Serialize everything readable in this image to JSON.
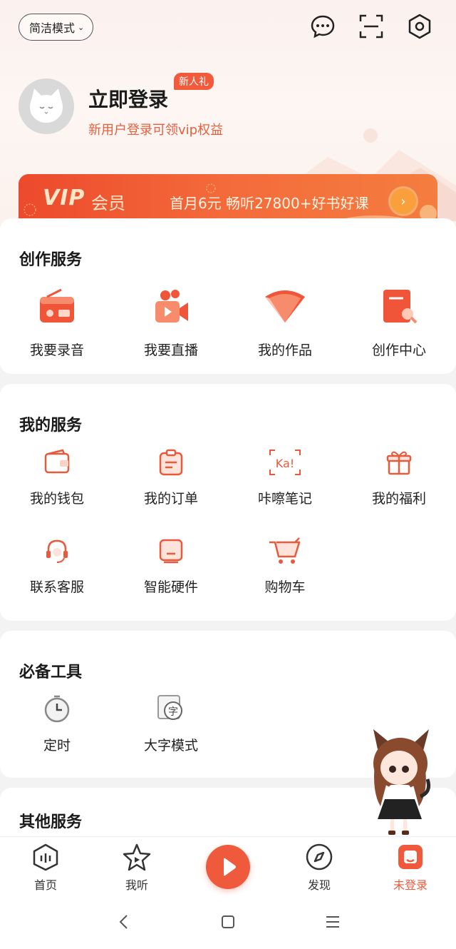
{
  "header": {
    "mode_label": "简洁模式",
    "icons": [
      "message-icon",
      "scan-icon",
      "settings-icon"
    ]
  },
  "profile": {
    "title": "立即登录",
    "badge": "新人礼",
    "subtitle": "新用户登录可领vip权益"
  },
  "vip": {
    "logo": "VIP",
    "member": "会员",
    "promo": "首月6元 畅听27800+好书好课"
  },
  "creation": {
    "title": "创作服务",
    "items": [
      {
        "label": "我要录音",
        "icon": "radio-icon"
      },
      {
        "label": "我要直播",
        "icon": "video-camera-icon"
      },
      {
        "label": "我的作品",
        "icon": "fan-icon"
      },
      {
        "label": "创作中心",
        "icon": "document-search-icon"
      }
    ]
  },
  "my_services": {
    "title": "我的服务",
    "items": [
      {
        "label": "我的钱包",
        "icon": "wallet-icon"
      },
      {
        "label": "我的订单",
        "icon": "clipboard-icon"
      },
      {
        "label": "咔嚓笔记",
        "icon": "ka-note-icon"
      },
      {
        "label": "我的福利",
        "icon": "gift-icon"
      },
      {
        "label": "联系客服",
        "icon": "headset-icon"
      },
      {
        "label": "智能硬件",
        "icon": "device-icon"
      },
      {
        "label": "购物车",
        "icon": "cart-icon"
      }
    ],
    "ka_text": "Ka!"
  },
  "tools": {
    "title": "必备工具",
    "items": [
      {
        "label": "定时",
        "icon": "timer-icon"
      },
      {
        "label": "大字模式",
        "icon": "large-font-icon"
      }
    ],
    "zi_text": "字"
  },
  "other": {
    "title": "其他服务"
  },
  "nav": {
    "items": [
      {
        "label": "首页",
        "icon": "home-icon"
      },
      {
        "label": "我听",
        "icon": "star-icon"
      },
      {
        "label": "发现",
        "icon": "compass-icon"
      },
      {
        "label": "未登录",
        "icon": "profile-icon"
      }
    ],
    "accent": "#f05a3c"
  },
  "colors": {
    "accent": "#f05a3c",
    "subtitle": "#e2613f"
  }
}
